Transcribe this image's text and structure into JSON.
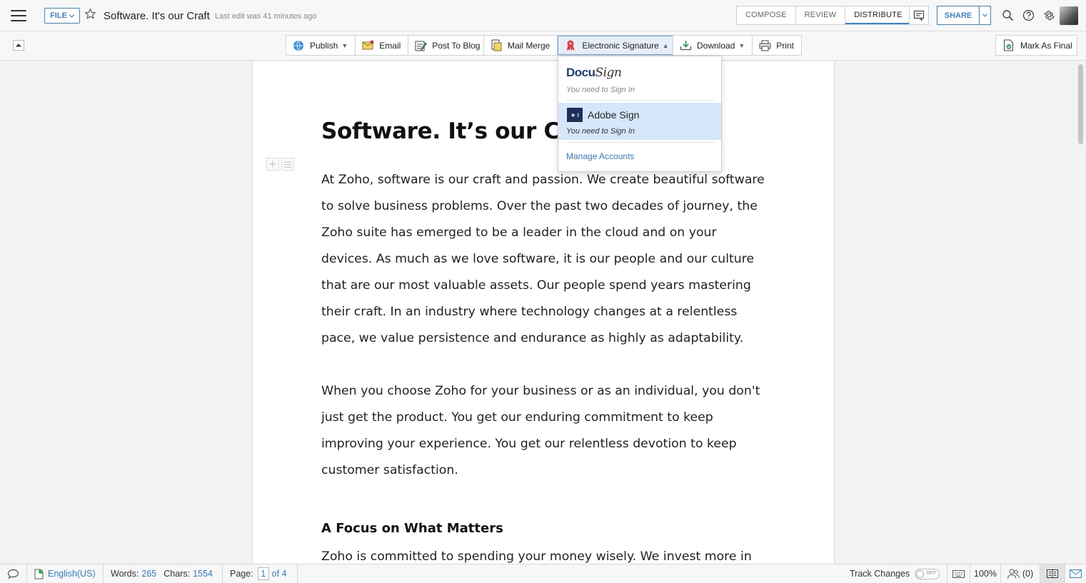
{
  "header": {
    "file_label": "FILE",
    "title": "Software. It's our Craft",
    "last_edit": "Last edit was 41 minutes ago",
    "modes": [
      "COMPOSE",
      "REVIEW",
      "DISTRIBUTE"
    ],
    "active_mode": "DISTRIBUTE",
    "share_label": "SHARE"
  },
  "ribbon": {
    "publish": "Publish",
    "email": "Email",
    "post_to_blog": "Post To Blog",
    "mail_merge": "Mail Merge",
    "electronic_signature": "Electronic Signature",
    "download": "Download",
    "print": "Print",
    "mark_as_final": "Mark As Final"
  },
  "dropdown": {
    "docusign_logo_a": "Docu",
    "docusign_logo_b": "Sign",
    "docusign_status": "You need to Sign In",
    "adobe_logo": "★ ℓ",
    "adobe_name": "Adobe Sign",
    "adobe_status": "You need to Sign In",
    "manage_accounts": "Manage Accounts"
  },
  "document": {
    "heading": "Software. It’s our Cra",
    "paragraph1_lines": [
      "At Zoho, software is our craft and passion. We create beautiful software",
      "to solve business problems. Over the past two decades of  journey, the",
      "Zoho suite has emerged to be a leader in the cloud and on your",
      "devices.   As much as we love software, it is our people and our culture",
      "that are our most valuable assets.   Our people spend years mastering",
      "their  craft. In an industry where technology changes at a relentless",
      "pace, we value persistence and endurance as highly as adaptability."
    ],
    "paragraph2_lines": [
      "When you choose Zoho for your business or as an individual, you don't",
      "just get the product. You get our enduring commitment to keep",
      "improving your experience.  You get our relentless devotion to keep",
      "customer satisfaction."
    ],
    "subheading": "A Focus on What Matters",
    "paragraph3_lines": [
      "Zoho is committed to spending your money wisely. We invest more in"
    ]
  },
  "status": {
    "language": "English(US)",
    "words_label": "Words:",
    "words": "265",
    "chars_label": "Chars:",
    "chars": "1554",
    "page_label": "Page:",
    "page_current": "1",
    "page_total": "of 4",
    "track_changes": "Track Changes",
    "track_state": "OFF",
    "zoom": "100%",
    "collaborators": "(0)"
  },
  "colors": {
    "accent": "#3a84d6",
    "link": "#2f7bd6",
    "dropdown_highlight": "#d7e7fb"
  }
}
